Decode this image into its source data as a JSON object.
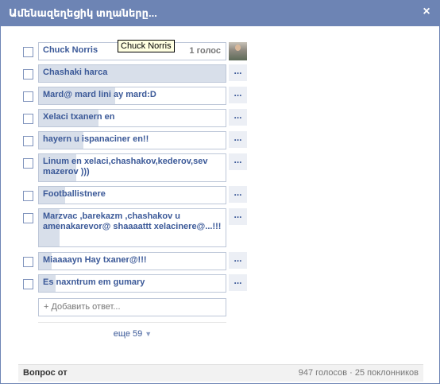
{
  "dialog": {
    "title": "Ամենազեղեցիկ տղաները...",
    "close_glyph": "×"
  },
  "tooltip": "Chuck Norris",
  "options": [
    {
      "label": "Chuck Norris",
      "votes_label": "1 голос",
      "fill": 0,
      "has_avatar": true
    },
    {
      "label": "Chashaki harca",
      "fill": 1.0
    },
    {
      "label": "Mard@ mard lini ay mard:D",
      "fill": 0.41
    },
    {
      "label": "Xelaci txanern en",
      "fill": 0.32
    },
    {
      "label": "hayern u ispanaciner en!!",
      "fill": 0.24
    },
    {
      "label": "Linum en xelaci,chashakov,kederov,sev mazerov )))",
      "fill": 0.2
    },
    {
      "label": "Footballistnere",
      "fill": 0.14
    },
    {
      "label": "Marzvac ,barekazm ,chashakov u amenakarevor@ shaaaattt xelacinere@...!!!",
      "fill": 0.11
    },
    {
      "label": "Miaaaayn Hay txaner@!!!",
      "fill": 0.07
    },
    {
      "label": "Es naxntrum em gumary",
      "fill": 0.09
    }
  ],
  "more_button_label": "...",
  "add_answer": {
    "placeholder": "+ Добавить ответ..."
  },
  "show_more": {
    "label": "еще 59",
    "arrow": "▼"
  },
  "footer": {
    "left": "Вопрос от",
    "right": "947 голосов · 25 поклонников"
  }
}
